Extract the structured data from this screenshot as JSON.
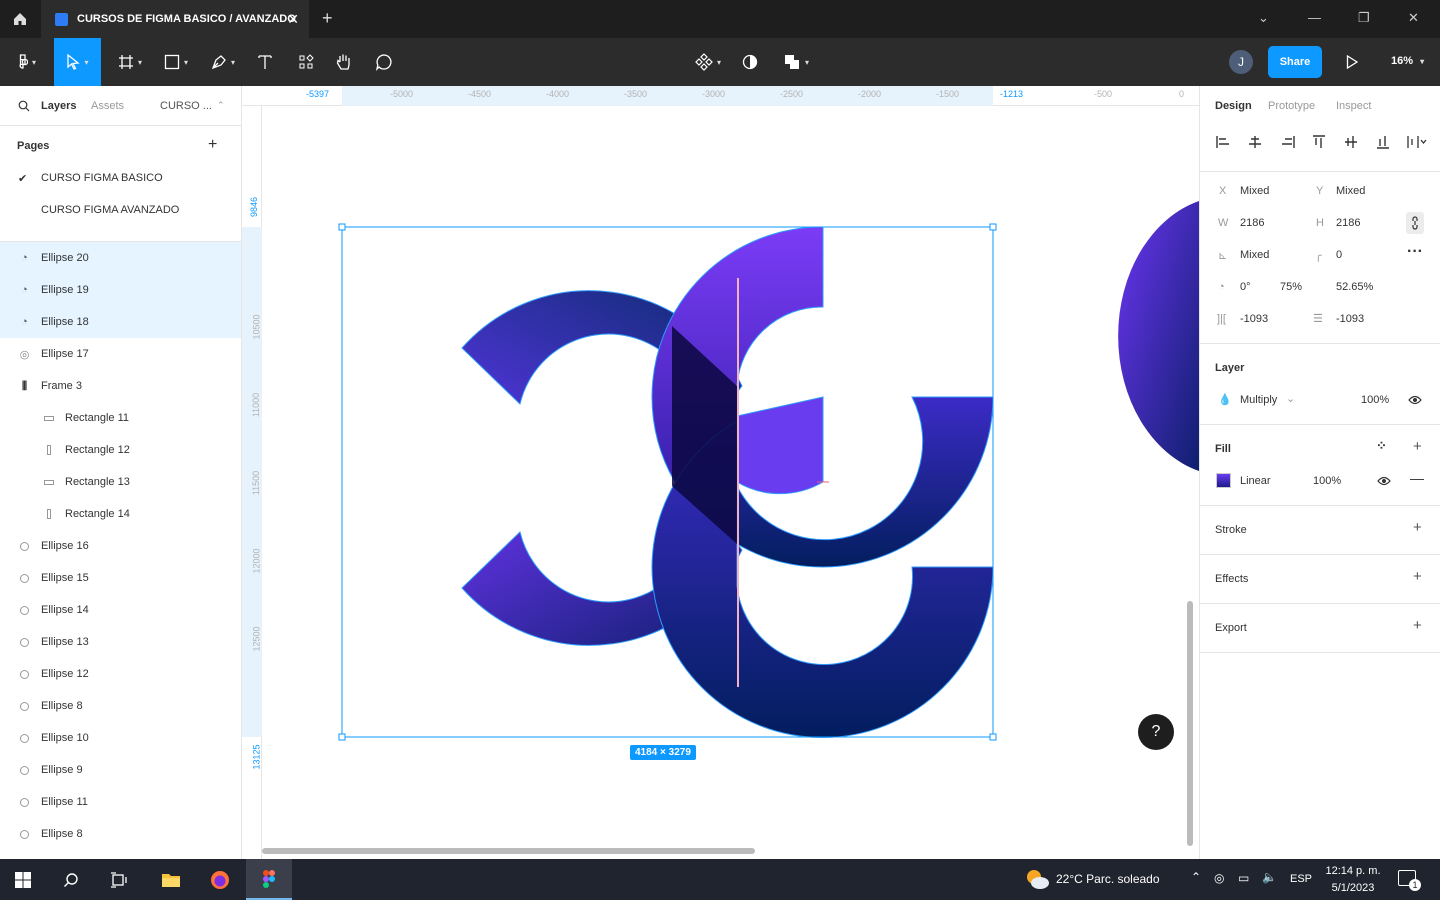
{
  "tab": {
    "title": "CURSOS DE FIGMA BASICO / AVANZADO"
  },
  "toolbar": {
    "share_label": "Share",
    "zoom": "16%",
    "avatar_initial": "J"
  },
  "left_panel": {
    "tabs": [
      "Layers",
      "Assets",
      "CURSO ..."
    ],
    "pages_label": "Pages",
    "pages": [
      {
        "name": "CURSO FIGMA BASICO",
        "current": true
      },
      {
        "name": "CURSO FIGMA AVANZADO",
        "current": false
      }
    ],
    "layers": [
      {
        "name": "Ellipse 20",
        "icon": "arc-icon",
        "selected": true,
        "indent": 0
      },
      {
        "name": "Ellipse 19",
        "icon": "arc-icon",
        "selected": true,
        "indent": 0
      },
      {
        "name": "Ellipse 18",
        "icon": "arc-icon",
        "selected": true,
        "indent": 0
      },
      {
        "name": "Ellipse 17",
        "icon": "ring-icon",
        "selected": false,
        "indent": 0
      },
      {
        "name": "Frame 3",
        "icon": "frame-columns-icon",
        "selected": false,
        "indent": 0
      },
      {
        "name": "Rectangle 11",
        "icon": "rect-h-icon",
        "selected": false,
        "indent": 1
      },
      {
        "name": "Rectangle 12",
        "icon": "rect-v-icon",
        "selected": false,
        "indent": 1
      },
      {
        "name": "Rectangle 13",
        "icon": "rect-h-icon",
        "selected": false,
        "indent": 1
      },
      {
        "name": "Rectangle 14",
        "icon": "rect-v-icon",
        "selected": false,
        "indent": 1
      },
      {
        "name": "Ellipse 16",
        "icon": "ellipse-icon",
        "selected": false,
        "indent": 0
      },
      {
        "name": "Ellipse 15",
        "icon": "ellipse-icon",
        "selected": false,
        "indent": 0
      },
      {
        "name": "Ellipse 14",
        "icon": "ellipse-icon",
        "selected": false,
        "indent": 0
      },
      {
        "name": "Ellipse 13",
        "icon": "ellipse-icon",
        "selected": false,
        "indent": 0
      },
      {
        "name": "Ellipse 12",
        "icon": "ellipse-icon",
        "selected": false,
        "indent": 0
      },
      {
        "name": "Ellipse 8",
        "icon": "ellipse-icon",
        "selected": false,
        "indent": 0
      },
      {
        "name": "Ellipse 10",
        "icon": "ellipse-icon",
        "selected": false,
        "indent": 0
      },
      {
        "name": "Ellipse 9",
        "icon": "ellipse-icon",
        "selected": false,
        "indent": 0
      },
      {
        "name": "Ellipse 11",
        "icon": "ellipse-icon",
        "selected": false,
        "indent": 0
      },
      {
        "name": "Ellipse 8",
        "icon": "ellipse-icon",
        "selected": false,
        "indent": 0
      }
    ]
  },
  "canvas": {
    "ruler_top": [
      "-5397",
      "-5000",
      "-4500",
      "-4000",
      "-3500",
      "-3000",
      "-2500",
      "-2000",
      "-1500",
      "-1213",
      "-500",
      "0"
    ],
    "ruler_left": [
      "9846",
      "10500",
      "11000",
      "11500",
      "12000",
      "12500",
      "13125"
    ],
    "selection_size": "4184 × 3279",
    "help_label": "?"
  },
  "right_panel": {
    "tabs": [
      "Design",
      "Prototype",
      "Inspect"
    ],
    "x_label": "X",
    "x_value": "Mixed",
    "y_label": "Y",
    "y_value": "Mixed",
    "w_label": "W",
    "w_value": "2186",
    "h_label": "H",
    "h_value": "2186",
    "rotation_value": "Mixed",
    "radius_value": "0",
    "arc_start": "0°",
    "arc_sweep": "75%",
    "arc_ratio": "52.65%",
    "spacing_x": "-1093",
    "spacing_y": "-1093",
    "layer_title": "Layer",
    "blend_mode": "Multiply",
    "layer_opacity": "100%",
    "fill_title": "Fill",
    "fill_type": "Linear",
    "fill_opacity": "100%",
    "fill_swatch_color": "#3b2bd6",
    "stroke_title": "Stroke",
    "effects_title": "Effects",
    "export_title": "Export"
  },
  "taskbar": {
    "weather": "22°C  Parc. soleado",
    "language": "ESP",
    "time": "12:14 p. m.",
    "date": "5/1/2023",
    "notifications": "1"
  },
  "colors": {
    "accent": "#0d99ff",
    "selection_bg": "#e5f4ff",
    "dark_ui": "#2c2c2c"
  }
}
